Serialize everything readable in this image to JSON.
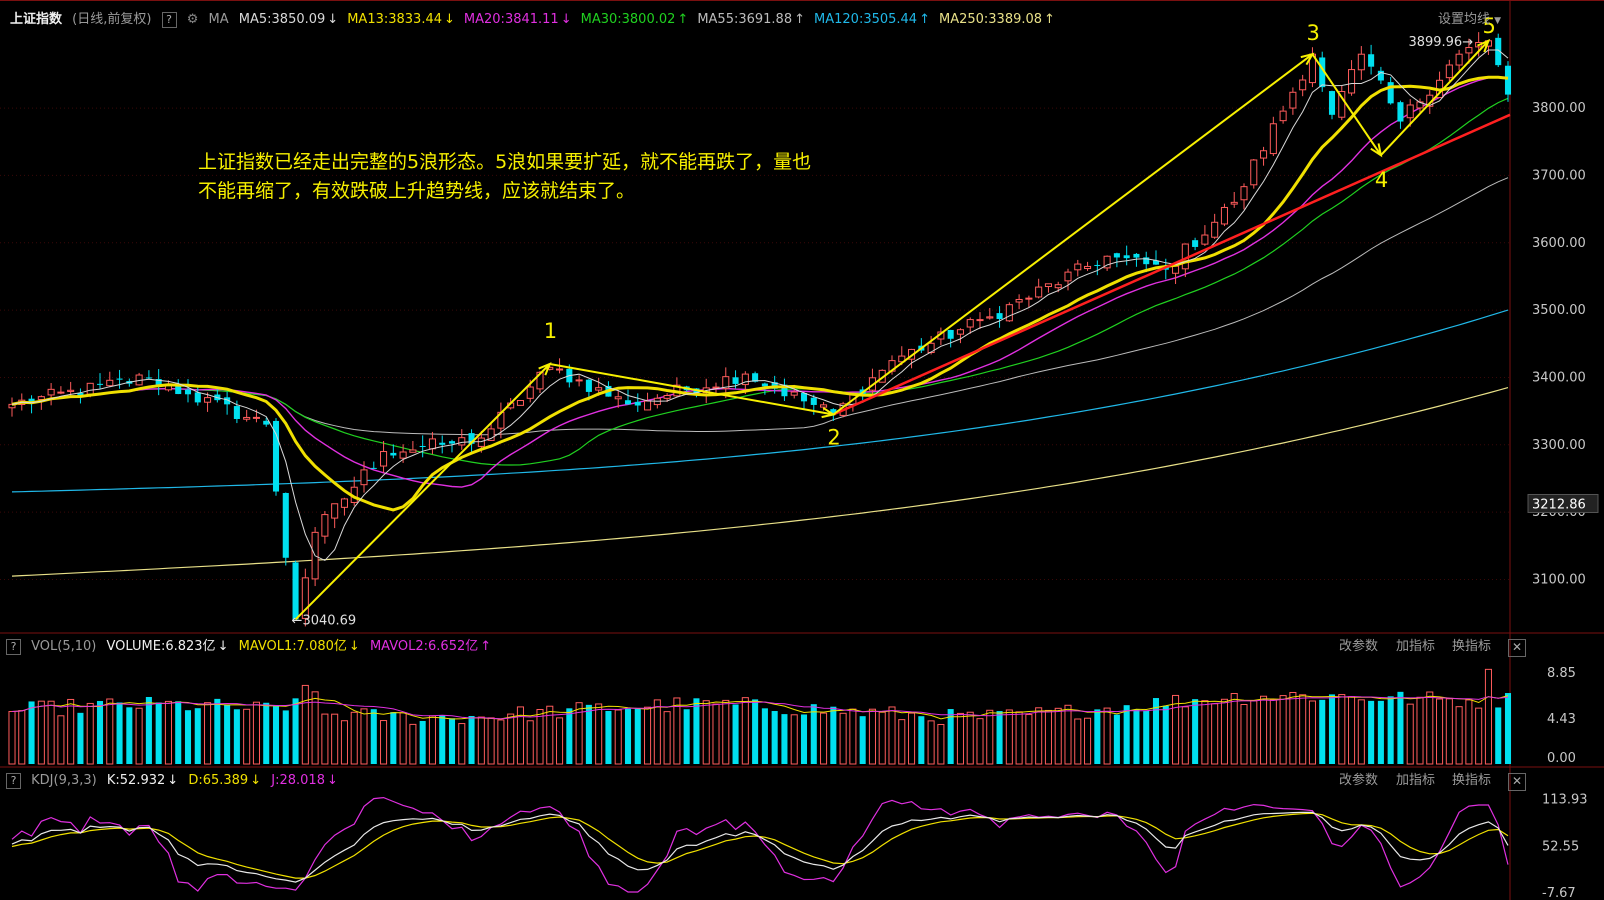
{
  "header": {
    "title": "上证指数",
    "mode": "(日线,前复权)",
    "ma_label": "MA",
    "ma_items": [
      {
        "text": "MA5:3850.09",
        "arrow": "↓",
        "color": "#d8d8d8"
      },
      {
        "text": "MA13:3833.44",
        "arrow": "↓",
        "color": "#f0e000"
      },
      {
        "text": "MA20:3841.11",
        "arrow": "↓",
        "color": "#e030e0"
      },
      {
        "text": "MA30:3800.02",
        "arrow": "↑",
        "color": "#20d020"
      },
      {
        "text": "MA55:3691.88",
        "arrow": "↑",
        "color": "#bbbbbb"
      },
      {
        "text": "MA120:3505.44",
        "arrow": "↑",
        "color": "#20b8e8"
      },
      {
        "text": "MA250:3389.08",
        "arrow": "↑",
        "color": "#e8e088"
      }
    ],
    "settings_label": "设置均线"
  },
  "annotation": {
    "line1": "上证指数已经走出完整的5浪形态。5浪如果要扩延，就不能再跌了，量也",
    "line2": "不能再缩了，有效跌破上升趋势线，应该就结束了。"
  },
  "vol_header": {
    "name": "VOL(5,10)",
    "volume": "VOLUME:6.823亿",
    "volume_arrow": "↓",
    "mavol1": "MAVOL1:7.080亿",
    "mavol1_arrow": "↓",
    "mavol2": "MAVOL2:6.652亿",
    "mavol2_arrow": "↑"
  },
  "kdj_header": {
    "name": "KDJ(9,3,3)",
    "k": "K:52.932",
    "k_arrow": "↓",
    "d": "D:65.389",
    "d_arrow": "↓",
    "j": "J:28.018",
    "j_arrow": "↓"
  },
  "panel_buttons": {
    "params": "改参数",
    "add": "加指标",
    "switch": "换指标",
    "close": "✕"
  },
  "help_icon": "?",
  "colors": {
    "up": "#ff5c5c",
    "down": "#00e0f0",
    "ma5": "#d8d8d8",
    "ma13": "#f0e000",
    "ma20": "#e030e0",
    "ma30": "#20d020",
    "ma55": "#bbbbbb",
    "ma120": "#20b8e8",
    "ma250": "#e8e088",
    "wave": "#f7f000",
    "trend": "#ff2020"
  },
  "chart_data": [
    {
      "type": "candlestick",
      "title": "上证指数",
      "ylim": [
        3025,
        3910
      ],
      "y_ticks": [
        3100,
        3200,
        3300,
        3400,
        3500,
        3600,
        3700,
        3800
      ],
      "current_price": 3212.86,
      "n_bars": 154,
      "anchor_points": [
        {
          "i": 0,
          "price": 3360
        },
        {
          "i": 14,
          "price": 3400
        },
        {
          "i": 18,
          "price": 3375
        },
        {
          "i": 26,
          "price": 3330
        },
        {
          "i": 29,
          "price": 3040.69
        },
        {
          "i": 31,
          "price": 3170
        },
        {
          "i": 38,
          "price": 3290
        },
        {
          "i": 44,
          "price": 3300
        },
        {
          "i": 48,
          "price": 3310
        },
        {
          "i": 55,
          "price": 3415
        },
        {
          "i": 63,
          "price": 3360
        },
        {
          "i": 75,
          "price": 3405
        },
        {
          "i": 84,
          "price": 3345
        },
        {
          "i": 90,
          "price": 3425
        },
        {
          "i": 100,
          "price": 3490
        },
        {
          "i": 112,
          "price": 3580
        },
        {
          "i": 118,
          "price": 3560
        },
        {
          "i": 125,
          "price": 3660
        },
        {
          "i": 133,
          "price": 3880
        },
        {
          "i": 135,
          "price": 3790
        },
        {
          "i": 138,
          "price": 3880
        },
        {
          "i": 142,
          "price": 3780
        },
        {
          "i": 148,
          "price": 3880
        },
        {
          "i": 151,
          "price": 3899.96
        },
        {
          "i": 153,
          "price": 3820
        }
      ],
      "high_label": "3899.96",
      "low_label": "3040.69",
      "moving_averages": [
        {
          "name": "MA5",
          "value": 3850.09
        },
        {
          "name": "MA13",
          "value": 3833.44
        },
        {
          "name": "MA20",
          "value": 3841.11
        },
        {
          "name": "MA30",
          "value": 3800.02
        },
        {
          "name": "MA55",
          "value": 3691.88
        },
        {
          "name": "MA120",
          "value": 3505.44
        },
        {
          "name": "MA250",
          "value": 3389.08
        }
      ],
      "wave_labels": [
        {
          "label": "1",
          "i": 55,
          "price": 3420
        },
        {
          "label": "2",
          "i": 84,
          "price": 3345
        },
        {
          "label": "3",
          "i": 133,
          "price": 3880
        },
        {
          "label": "4",
          "i": 140,
          "price": 3730
        },
        {
          "label": "5",
          "i": 151,
          "price": 3899.96
        }
      ]
    },
    {
      "type": "bar",
      "title": "VOL(5,10)",
      "ylim": [
        0,
        10
      ],
      "y_ticks": [
        0.0,
        4.43,
        8.85
      ],
      "volume_last": 6.823,
      "mavol1": 7.08,
      "mavol2": 6.652
    },
    {
      "type": "line",
      "title": "KDJ(9,3,3)",
      "ylim": [
        -7.67,
        125
      ],
      "y_ticks": [
        -7.67,
        52.55,
        113.93
      ],
      "series": [
        {
          "name": "K",
          "last": 52.932
        },
        {
          "name": "D",
          "last": 65.389
        },
        {
          "name": "J",
          "last": 28.018
        }
      ]
    }
  ]
}
